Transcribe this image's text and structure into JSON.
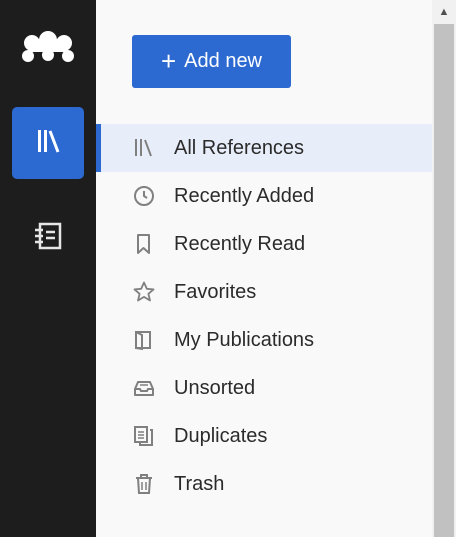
{
  "rail": {
    "logo_icon": "mendeley-logo-icon",
    "library_icon": "library-icon",
    "notebook_icon": "notebook-icon",
    "accent_color": "#2c69d1"
  },
  "add_button": {
    "label": "Add new",
    "icon": "plus-icon"
  },
  "nav": {
    "items": [
      {
        "label": "All References",
        "icon": "library-icon",
        "active": true
      },
      {
        "label": "Recently Added",
        "icon": "clock-icon"
      },
      {
        "label": "Recently Read",
        "icon": "bookmark-icon"
      },
      {
        "label": "Favorites",
        "icon": "star-icon"
      },
      {
        "label": "My Publications",
        "icon": "publication-icon"
      },
      {
        "label": "Unsorted",
        "icon": "inbox-tray-icon"
      },
      {
        "label": "Duplicates",
        "icon": "duplicates-icon"
      },
      {
        "label": "Trash",
        "icon": "trash-icon"
      }
    ]
  },
  "scrollbar": {
    "up_icon": "scroll-up-arrow-icon"
  }
}
